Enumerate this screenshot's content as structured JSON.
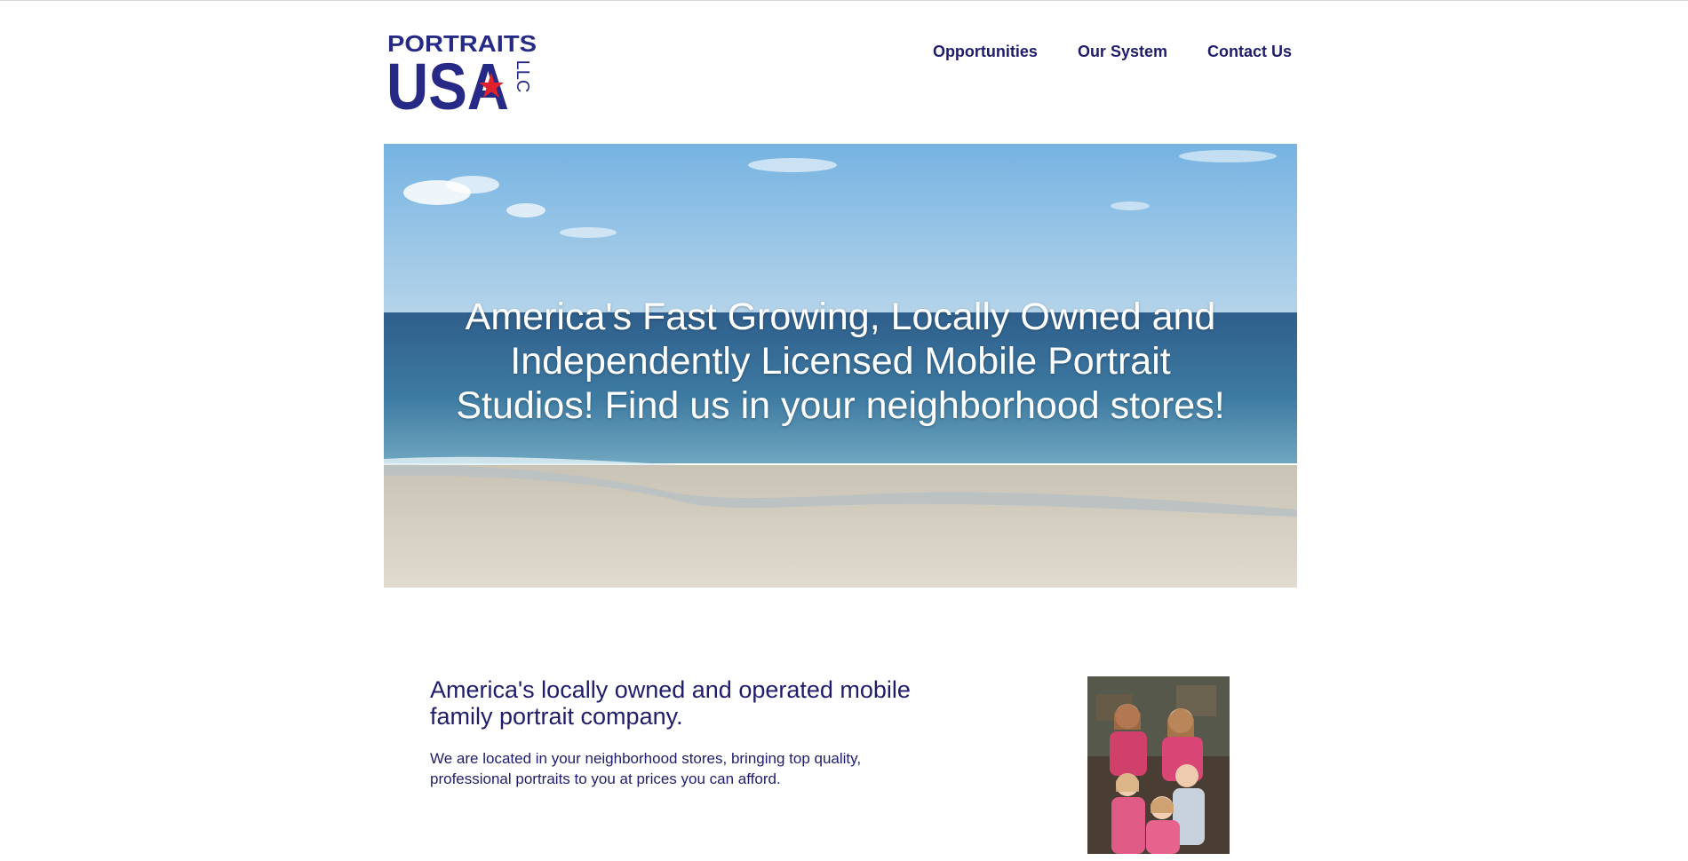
{
  "brand": {
    "logo_top": "PORTRAITS",
    "logo_main": "USA",
    "logo_suffix": "LLC",
    "navy": "#262a86",
    "star_red": "#e0202a"
  },
  "nav": {
    "items": [
      {
        "label": "Opportunities"
      },
      {
        "label": "Our System"
      },
      {
        "label": "Contact Us"
      }
    ]
  },
  "hero": {
    "headline": "America's Fast Growing, Locally Owned and Independently Licensed Mobile Portrait Studios! Find us in your neighborhood stores!"
  },
  "intro": {
    "heading": "America's locally owned and operated mobile family portrait company.",
    "body": "We are located in your neighborhood stores, bringing top quality, professional portraits to you at prices you can afford."
  },
  "colors": {
    "text": "#1f1d6b",
    "sky": "#7fb6e0",
    "sea": "#3a6f99",
    "sand": "#d9d3c6"
  }
}
